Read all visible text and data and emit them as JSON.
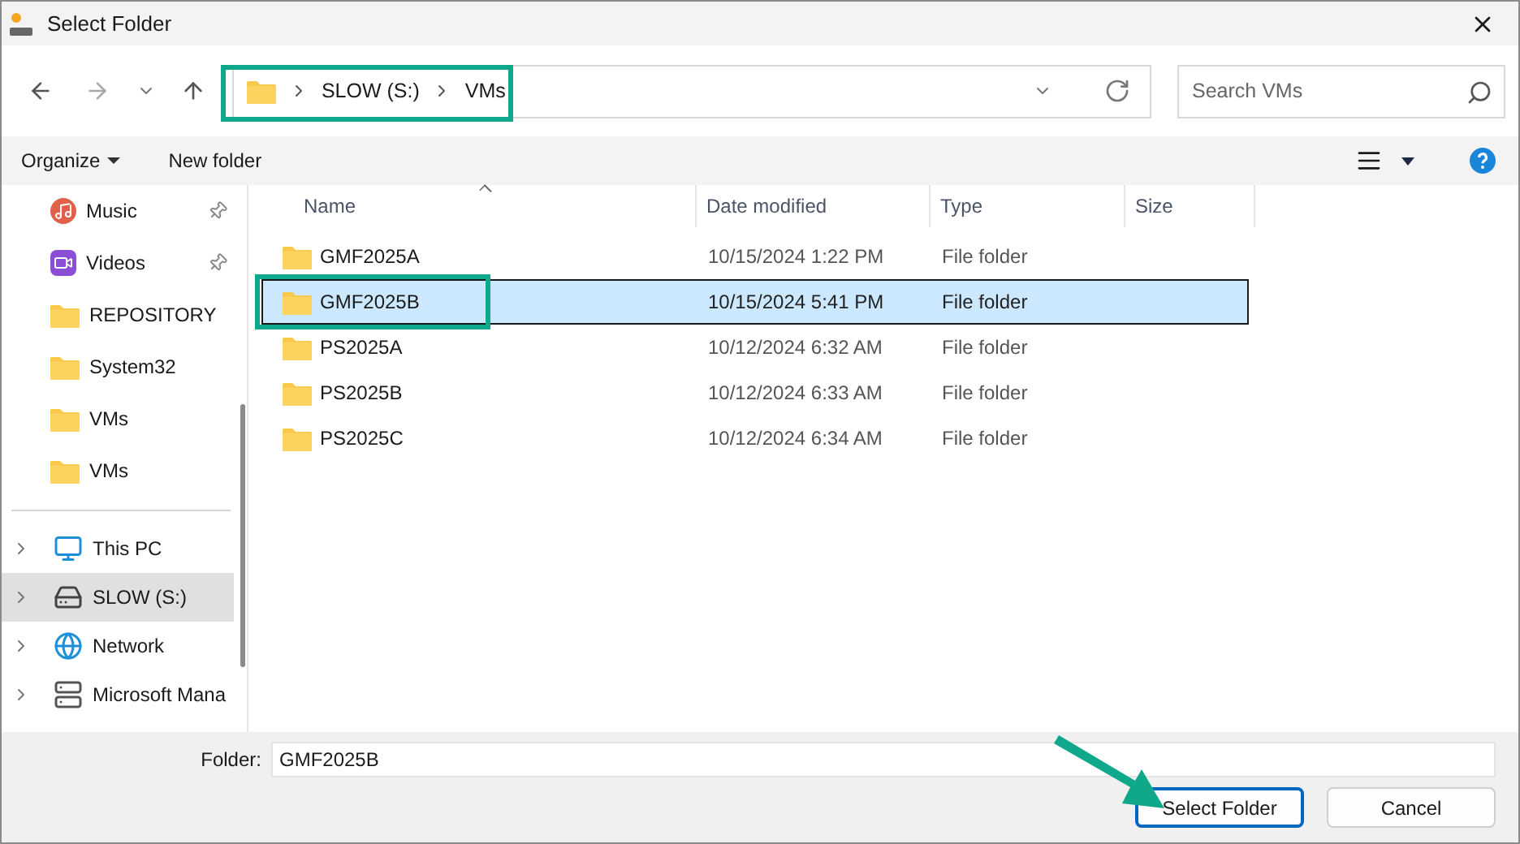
{
  "window": {
    "title": "Select Folder"
  },
  "address_bar": {
    "crumbs": [
      "SLOW (S:)",
      "VMs"
    ],
    "highlighted": true
  },
  "search": {
    "placeholder": "Search VMs"
  },
  "toolbar": {
    "organize": "Organize",
    "new_folder": "New folder"
  },
  "sidebar": {
    "items": [
      {
        "label": "Music",
        "kind": "music",
        "pinned": true,
        "selected": false
      },
      {
        "label": "Videos",
        "kind": "videos",
        "pinned": true,
        "selected": false
      },
      {
        "label": "REPOSITORY",
        "kind": "folder",
        "pinned": false,
        "selected": false
      },
      {
        "label": "System32",
        "kind": "folder",
        "pinned": false,
        "selected": false
      },
      {
        "label": "VMs",
        "kind": "folder",
        "pinned": false,
        "selected": false
      },
      {
        "label": "VMs",
        "kind": "folder",
        "pinned": false,
        "selected": false
      }
    ],
    "locations": [
      {
        "label": "This PC",
        "kind": "pc",
        "expandable": true,
        "selected": false
      },
      {
        "label": "SLOW (S:)",
        "kind": "drive",
        "expandable": true,
        "selected": true
      },
      {
        "label": "Network",
        "kind": "network",
        "expandable": true,
        "selected": false
      },
      {
        "label": "Microsoft Mana",
        "kind": "server",
        "expandable": true,
        "selected": false
      }
    ]
  },
  "table": {
    "columns": [
      {
        "label": "Name",
        "sorted": true
      },
      {
        "label": "Date modified",
        "sorted": false
      },
      {
        "label": "Type",
        "sorted": false
      },
      {
        "label": "Size",
        "sorted": false
      }
    ],
    "rows": [
      {
        "name": "GMF2025A",
        "date": "10/15/2024 1:22 PM",
        "type": "File folder",
        "selected": false,
        "highlighted": false
      },
      {
        "name": "GMF2025B",
        "date": "10/15/2024 5:41 PM",
        "type": "File folder",
        "selected": true,
        "highlighted": true
      },
      {
        "name": "PS2025A",
        "date": "10/12/2024 6:32 AM",
        "type": "File folder",
        "selected": false,
        "highlighted": false
      },
      {
        "name": "PS2025B",
        "date": "10/12/2024 6:33 AM",
        "type": "File folder",
        "selected": false,
        "highlighted": false
      },
      {
        "name": "PS2025C",
        "date": "10/12/2024 6:34 AM",
        "type": "File folder",
        "selected": false,
        "highlighted": false
      }
    ]
  },
  "folder_field": {
    "label": "Folder:",
    "value": "GMF2025B"
  },
  "buttons": [
    {
      "label": "Select Folder",
      "primary": true,
      "pointed": true
    },
    {
      "label": "Cancel",
      "primary": false,
      "pointed": false
    }
  ]
}
